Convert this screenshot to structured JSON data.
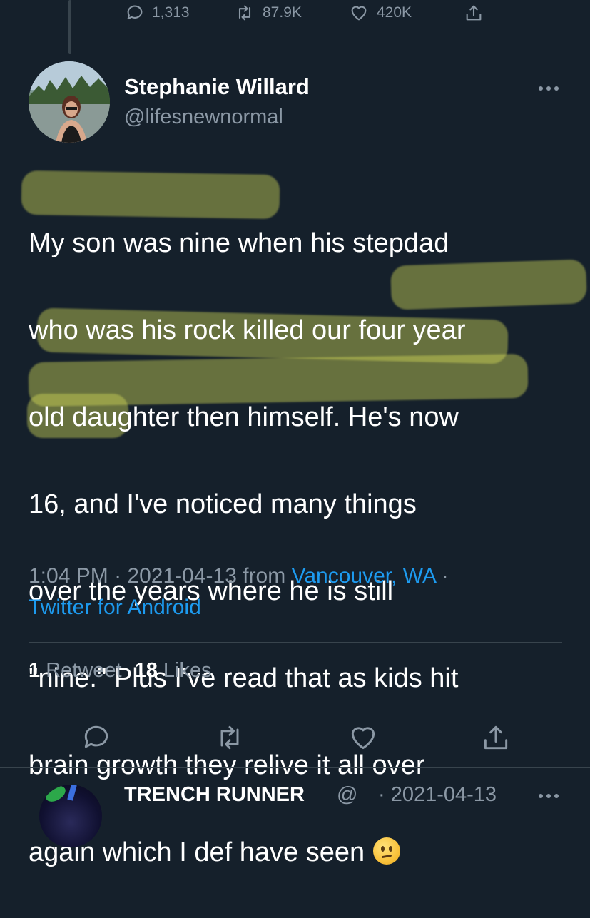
{
  "previous_tweet_actions": {
    "replies": "1,313",
    "retweets": "87.9K",
    "likes": "420K"
  },
  "author": {
    "name": "Stephanie Willard",
    "handle": "@lifesnewnormal"
  },
  "tweet": {
    "text_lines": [
      "My son was nine when his stepdad",
      "who was his rock killed our four year",
      "old daughter then himself. He's now",
      "16, and I've noticed many things",
      "over the years where he is still",
      "\"nine.\" Plus I've read that as kids hit",
      "brain growth they relive it all over",
      "again which I def have seen"
    ],
    "emoji": "confused-face",
    "highlight_color": "#d9e05a"
  },
  "meta": {
    "time": "1:04 PM",
    "date": "2021-04-13",
    "from_label": "from",
    "location": "Vancouver, WA",
    "separator": "·",
    "client": "Twitter for Android"
  },
  "stats": {
    "retweets_count": "1",
    "retweets_label": "Retweet",
    "likes_count": "18",
    "likes_label": "Likes"
  },
  "action_icons": [
    "reply-icon",
    "retweet-icon",
    "like-icon",
    "share-icon"
  ],
  "next_tweet": {
    "name": "TRENCH RUNNER",
    "handle_fragment": "@",
    "date_fragment": "· 2021-04-13"
  },
  "colors": {
    "background": "#15202b",
    "text": "#ffffff",
    "secondary": "#8b98a5",
    "link": "#1d9bf0",
    "divider": "#38444d"
  }
}
